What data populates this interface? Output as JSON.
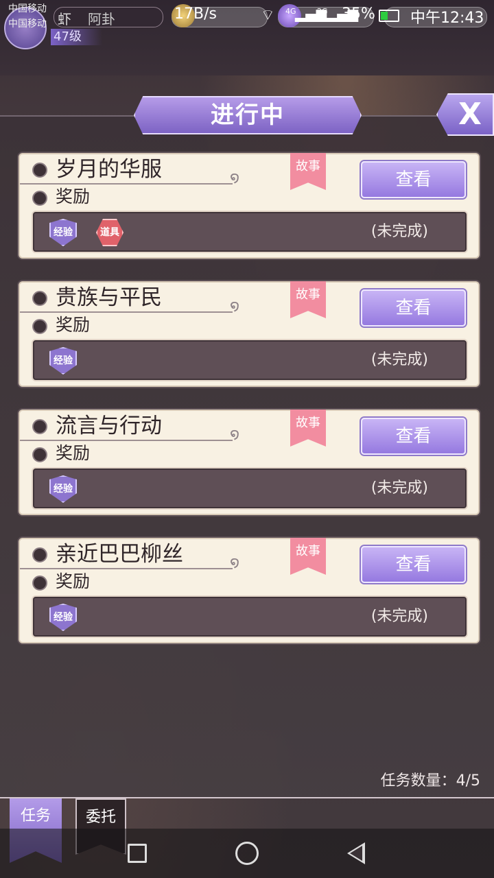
{
  "status_bar": {
    "carrier1": "中国移动",
    "carrier2": "中国移动",
    "net_speed": "17B/s",
    "signal_2g": "2G",
    "signal_4g": "4G",
    "battery": "35%",
    "time": "中午12:43"
  },
  "player": {
    "name_prefix": "虾",
    "name": "阿卦",
    "level": "47级"
  },
  "panel": {
    "title": "进行中",
    "close_label": "X"
  },
  "quests": [
    {
      "title": "岁月的华服",
      "tag": "故事",
      "reward_label": "奖励",
      "view_label": "查看",
      "rewards": [
        "经验",
        "道具"
      ],
      "status": "(未完成)"
    },
    {
      "title": "贵族与平民",
      "tag": "故事",
      "reward_label": "奖励",
      "view_label": "查看",
      "rewards": [
        "经验"
      ],
      "status": "(未完成)"
    },
    {
      "title": "流言与行动",
      "tag": "故事",
      "reward_label": "奖励",
      "view_label": "查看",
      "rewards": [
        "经验"
      ],
      "status": "(未完成)"
    },
    {
      "title": "亲近巴巴柳丝",
      "tag": "故事",
      "reward_label": "奖励",
      "view_label": "查看",
      "rewards": [
        "经验"
      ],
      "status": "(未完成)"
    }
  ],
  "quest_count": "任务数量：4/5",
  "tabs": {
    "task": "任务",
    "delegate": "委托"
  },
  "icons": {
    "title": "crown-icon",
    "reward": "gift-icon",
    "exp": "exp-badge-icon",
    "item": "item-badge-icon",
    "close": "close-icon"
  },
  "colors": {
    "accent": "#9579e0",
    "tag": "#f28da0",
    "card": "#f8f1e3"
  }
}
